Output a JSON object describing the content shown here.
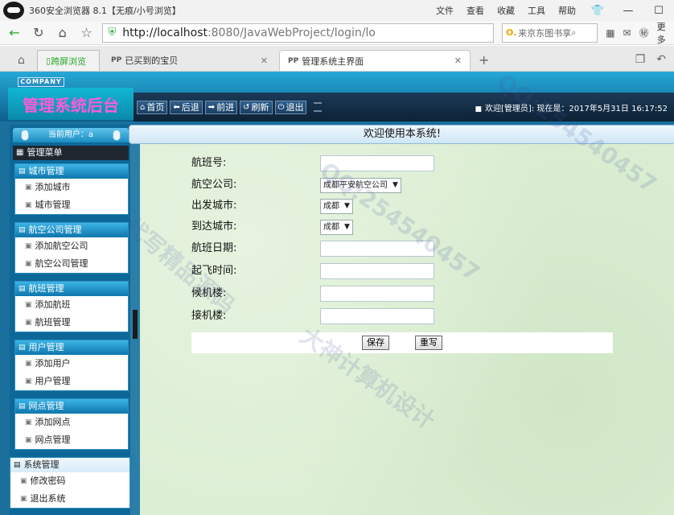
{
  "browser": {
    "title": "360安全浏览器 8.1【无痕/小号浏览】",
    "menus": [
      "文件",
      "查看",
      "收藏",
      "工具",
      "帮助"
    ],
    "url_host": "http://localhost",
    "url_rest": ":8080/JavaWebProject/login/lo",
    "search_placeholder": "来京东图书享",
    "more_label": "更多",
    "tabs": [
      {
        "label": "跨屏浏览"
      },
      {
        "label": "已买到的宝贝"
      },
      {
        "label": "管理系统主界面",
        "active": true
      }
    ]
  },
  "app": {
    "company_badge": "COMPANY",
    "brand_title": "管理系统后台",
    "toolbar": {
      "home": "首页",
      "back": "后退",
      "forward": "前进",
      "refresh": "刷新",
      "logout": "退出",
      "welcome": "欢迎[管理员]:  现在是：2017年5月31日  16:17:52"
    },
    "sidebar": {
      "current_user": "当前用户：a",
      "menu_title": "管理菜单",
      "groups": [
        {
          "title": "城市管理",
          "items": [
            "添加城市",
            "城市管理"
          ]
        },
        {
          "title": "航空公司管理",
          "items": [
            "添加航空公司",
            "航空公司管理"
          ]
        },
        {
          "title": "航班管理",
          "items": [
            "添加航班",
            "航班管理"
          ]
        },
        {
          "title": "用户管理",
          "items": [
            "添加用户",
            "用户管理"
          ]
        },
        {
          "title": "网点管理",
          "items": [
            "添加网点",
            "网点管理"
          ]
        },
        {
          "title": "系统管理",
          "items": [
            "修改密码",
            "退出系统"
          ]
        }
      ]
    },
    "main": {
      "banner": "欢迎使用本系统!",
      "form": {
        "flight_no_label": "航班号:",
        "airline_label": "航空公司:",
        "airline_value": "成都平安航空公司",
        "from_city_label": "出发城市:",
        "from_city_value": "成都",
        "to_city_label": "到达城市:",
        "to_city_value": "成都",
        "flight_date_label": "航班日期:",
        "takeoff_time_label": "起飞时间:",
        "departure_terminal_label": "候机楼:",
        "arrival_terminal_label": "接机楼:",
        "save_label": "保存",
        "reset_label": "重写"
      }
    },
    "watermarks": [
      "QQ:254540457",
      "大神计算机设计",
      "代写精品源码"
    ]
  }
}
